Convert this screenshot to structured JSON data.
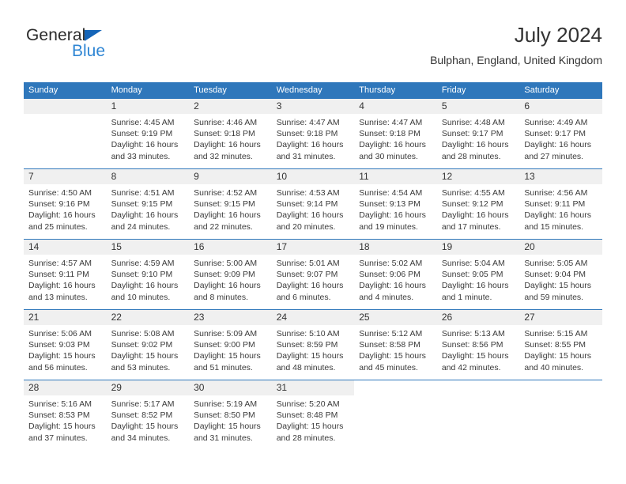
{
  "brand": {
    "name_part1": "General",
    "name_part2": "Blue",
    "triangle_icon": "triangle-icon",
    "colors": {
      "dark": "#2b2b2b",
      "blue": "#2f86d4",
      "triangle": "#1565b8"
    }
  },
  "header": {
    "title": "July 2024",
    "subtitle": "Bulphan, England, United Kingdom"
  },
  "theme": {
    "header_blue": "#2f77bb",
    "daynum_gray": "#f0f0f0",
    "rule_blue": "#2f77bb",
    "text": "#333333"
  },
  "calendar": {
    "weekday_headers": [
      "Sunday",
      "Monday",
      "Tuesday",
      "Wednesday",
      "Thursday",
      "Friday",
      "Saturday"
    ],
    "weeks": [
      [
        {
          "day": "",
          "sunrise": "",
          "sunset": "",
          "daylight_line1": "",
          "daylight_line2": ""
        },
        {
          "day": "1",
          "sunrise": "Sunrise: 4:45 AM",
          "sunset": "Sunset: 9:19 PM",
          "daylight_line1": "Daylight: 16 hours",
          "daylight_line2": "and 33 minutes."
        },
        {
          "day": "2",
          "sunrise": "Sunrise: 4:46 AM",
          "sunset": "Sunset: 9:18 PM",
          "daylight_line1": "Daylight: 16 hours",
          "daylight_line2": "and 32 minutes."
        },
        {
          "day": "3",
          "sunrise": "Sunrise: 4:47 AM",
          "sunset": "Sunset: 9:18 PM",
          "daylight_line1": "Daylight: 16 hours",
          "daylight_line2": "and 31 minutes."
        },
        {
          "day": "4",
          "sunrise": "Sunrise: 4:47 AM",
          "sunset": "Sunset: 9:18 PM",
          "daylight_line1": "Daylight: 16 hours",
          "daylight_line2": "and 30 minutes."
        },
        {
          "day": "5",
          "sunrise": "Sunrise: 4:48 AM",
          "sunset": "Sunset: 9:17 PM",
          "daylight_line1": "Daylight: 16 hours",
          "daylight_line2": "and 28 minutes."
        },
        {
          "day": "6",
          "sunrise": "Sunrise: 4:49 AM",
          "sunset": "Sunset: 9:17 PM",
          "daylight_line1": "Daylight: 16 hours",
          "daylight_line2": "and 27 minutes."
        }
      ],
      [
        {
          "day": "7",
          "sunrise": "Sunrise: 4:50 AM",
          "sunset": "Sunset: 9:16 PM",
          "daylight_line1": "Daylight: 16 hours",
          "daylight_line2": "and 25 minutes."
        },
        {
          "day": "8",
          "sunrise": "Sunrise: 4:51 AM",
          "sunset": "Sunset: 9:15 PM",
          "daylight_line1": "Daylight: 16 hours",
          "daylight_line2": "and 24 minutes."
        },
        {
          "day": "9",
          "sunrise": "Sunrise: 4:52 AM",
          "sunset": "Sunset: 9:15 PM",
          "daylight_line1": "Daylight: 16 hours",
          "daylight_line2": "and 22 minutes."
        },
        {
          "day": "10",
          "sunrise": "Sunrise: 4:53 AM",
          "sunset": "Sunset: 9:14 PM",
          "daylight_line1": "Daylight: 16 hours",
          "daylight_line2": "and 20 minutes."
        },
        {
          "day": "11",
          "sunrise": "Sunrise: 4:54 AM",
          "sunset": "Sunset: 9:13 PM",
          "daylight_line1": "Daylight: 16 hours",
          "daylight_line2": "and 19 minutes."
        },
        {
          "day": "12",
          "sunrise": "Sunrise: 4:55 AM",
          "sunset": "Sunset: 9:12 PM",
          "daylight_line1": "Daylight: 16 hours",
          "daylight_line2": "and 17 minutes."
        },
        {
          "day": "13",
          "sunrise": "Sunrise: 4:56 AM",
          "sunset": "Sunset: 9:11 PM",
          "daylight_line1": "Daylight: 16 hours",
          "daylight_line2": "and 15 minutes."
        }
      ],
      [
        {
          "day": "14",
          "sunrise": "Sunrise: 4:57 AM",
          "sunset": "Sunset: 9:11 PM",
          "daylight_line1": "Daylight: 16 hours",
          "daylight_line2": "and 13 minutes."
        },
        {
          "day": "15",
          "sunrise": "Sunrise: 4:59 AM",
          "sunset": "Sunset: 9:10 PM",
          "daylight_line1": "Daylight: 16 hours",
          "daylight_line2": "and 10 minutes."
        },
        {
          "day": "16",
          "sunrise": "Sunrise: 5:00 AM",
          "sunset": "Sunset: 9:09 PM",
          "daylight_line1": "Daylight: 16 hours",
          "daylight_line2": "and 8 minutes."
        },
        {
          "day": "17",
          "sunrise": "Sunrise: 5:01 AM",
          "sunset": "Sunset: 9:07 PM",
          "daylight_line1": "Daylight: 16 hours",
          "daylight_line2": "and 6 minutes."
        },
        {
          "day": "18",
          "sunrise": "Sunrise: 5:02 AM",
          "sunset": "Sunset: 9:06 PM",
          "daylight_line1": "Daylight: 16 hours",
          "daylight_line2": "and 4 minutes."
        },
        {
          "day": "19",
          "sunrise": "Sunrise: 5:04 AM",
          "sunset": "Sunset: 9:05 PM",
          "daylight_line1": "Daylight: 16 hours",
          "daylight_line2": "and 1 minute."
        },
        {
          "day": "20",
          "sunrise": "Sunrise: 5:05 AM",
          "sunset": "Sunset: 9:04 PM",
          "daylight_line1": "Daylight: 15 hours",
          "daylight_line2": "and 59 minutes."
        }
      ],
      [
        {
          "day": "21",
          "sunrise": "Sunrise: 5:06 AM",
          "sunset": "Sunset: 9:03 PM",
          "daylight_line1": "Daylight: 15 hours",
          "daylight_line2": "and 56 minutes."
        },
        {
          "day": "22",
          "sunrise": "Sunrise: 5:08 AM",
          "sunset": "Sunset: 9:02 PM",
          "daylight_line1": "Daylight: 15 hours",
          "daylight_line2": "and 53 minutes."
        },
        {
          "day": "23",
          "sunrise": "Sunrise: 5:09 AM",
          "sunset": "Sunset: 9:00 PM",
          "daylight_line1": "Daylight: 15 hours",
          "daylight_line2": "and 51 minutes."
        },
        {
          "day": "24",
          "sunrise": "Sunrise: 5:10 AM",
          "sunset": "Sunset: 8:59 PM",
          "daylight_line1": "Daylight: 15 hours",
          "daylight_line2": "and 48 minutes."
        },
        {
          "day": "25",
          "sunrise": "Sunrise: 5:12 AM",
          "sunset": "Sunset: 8:58 PM",
          "daylight_line1": "Daylight: 15 hours",
          "daylight_line2": "and 45 minutes."
        },
        {
          "day": "26",
          "sunrise": "Sunrise: 5:13 AM",
          "sunset": "Sunset: 8:56 PM",
          "daylight_line1": "Daylight: 15 hours",
          "daylight_line2": "and 42 minutes."
        },
        {
          "day": "27",
          "sunrise": "Sunrise: 5:15 AM",
          "sunset": "Sunset: 8:55 PM",
          "daylight_line1": "Daylight: 15 hours",
          "daylight_line2": "and 40 minutes."
        }
      ],
      [
        {
          "day": "28",
          "sunrise": "Sunrise: 5:16 AM",
          "sunset": "Sunset: 8:53 PM",
          "daylight_line1": "Daylight: 15 hours",
          "daylight_line2": "and 37 minutes."
        },
        {
          "day": "29",
          "sunrise": "Sunrise: 5:17 AM",
          "sunset": "Sunset: 8:52 PM",
          "daylight_line1": "Daylight: 15 hours",
          "daylight_line2": "and 34 minutes."
        },
        {
          "day": "30",
          "sunrise": "Sunrise: 5:19 AM",
          "sunset": "Sunset: 8:50 PM",
          "daylight_line1": "Daylight: 15 hours",
          "daylight_line2": "and 31 minutes."
        },
        {
          "day": "31",
          "sunrise": "Sunrise: 5:20 AM",
          "sunset": "Sunset: 8:48 PM",
          "daylight_line1": "Daylight: 15 hours",
          "daylight_line2": "and 28 minutes."
        },
        {
          "day": "",
          "sunrise": "",
          "sunset": "",
          "daylight_line1": "",
          "daylight_line2": ""
        },
        {
          "day": "",
          "sunrise": "",
          "sunset": "",
          "daylight_line1": "",
          "daylight_line2": ""
        },
        {
          "day": "",
          "sunrise": "",
          "sunset": "",
          "daylight_line1": "",
          "daylight_line2": ""
        }
      ]
    ]
  }
}
